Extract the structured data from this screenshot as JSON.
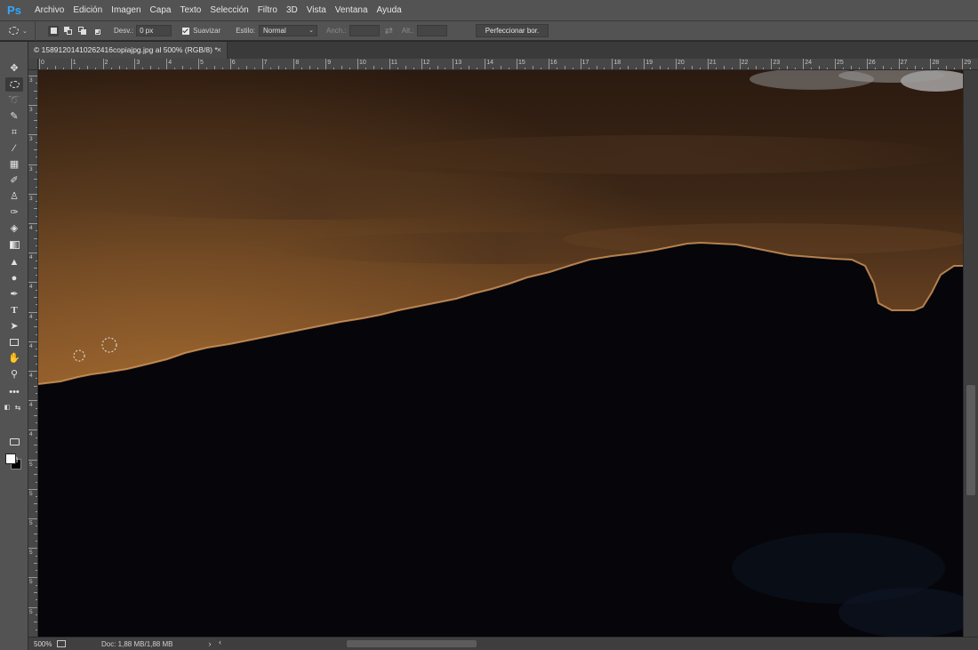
{
  "app": {
    "logo": "Ps"
  },
  "menu": [
    "Archivo",
    "Edición",
    "Imagen",
    "Capa",
    "Texto",
    "Selección",
    "Filtro",
    "3D",
    "Vista",
    "Ventana",
    "Ayuda"
  ],
  "options": {
    "feather_label": "Desv.:",
    "feather_value": "0 px",
    "antialias_label": "Suavizar",
    "style_label": "Estilo:",
    "style_value": "Normal",
    "width_label": "Anch.:",
    "height_label": "Alt.:",
    "refine_button": "Perfeccionar bor."
  },
  "document": {
    "tab_title": "© 15891201410262416copiajpg.jpg al 500% (RGB/8) *",
    "close": "×"
  },
  "ruler": {
    "h_ticks": [
      "0",
      "1",
      "2",
      "3",
      "4",
      "5",
      "6",
      "7",
      "8",
      "9",
      "10",
      "11",
      "12",
      "13",
      "14",
      "15",
      "16",
      "17",
      "18",
      "19",
      "20",
      "21",
      "22",
      "23",
      "24",
      "25",
      "26",
      "27",
      "28",
      "29"
    ],
    "v_ticks": [
      "3",
      "3",
      "3",
      "3",
      "3",
      "4",
      "4",
      "4",
      "4",
      "4",
      "4",
      "4",
      "4",
      "5",
      "5",
      "5",
      "5",
      "5",
      "5"
    ]
  },
  "status": {
    "zoom": "500%",
    "doc_info": "Doc: 1,88 MB/1,88 MB",
    "arrow": "›"
  },
  "colors": {
    "foreground": "#ffffff",
    "background": "#000000",
    "sky_top": "#3a2414",
    "sky_horizon": "#a4662e",
    "mountain": "#05050a",
    "selection_edge": "#e0a060"
  },
  "tools": [
    "move-icon",
    "elliptical-marquee-icon",
    "lasso-icon",
    "quick-selection-icon",
    "crop-icon",
    "eyedropper-icon",
    "healing-brush-icon",
    "brush-icon",
    "clone-stamp-icon",
    "history-brush-icon",
    "eraser-icon",
    "gradient-icon",
    "blur-icon",
    "dodge-icon",
    "pen-icon",
    "type-icon",
    "path-selection-icon",
    "rectangle-icon",
    "hand-icon",
    "zoom-icon",
    "more-tools-icon"
  ]
}
